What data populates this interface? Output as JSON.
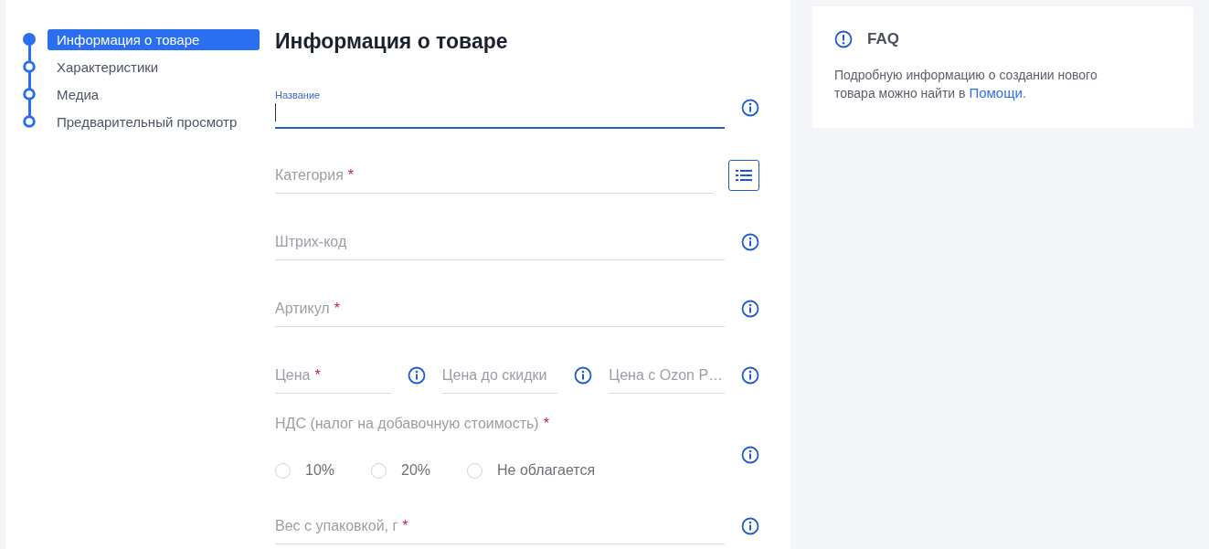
{
  "steps": [
    {
      "label": "Информация о товаре",
      "selected": true
    },
    {
      "label": "Характеристики",
      "selected": false
    },
    {
      "label": "Медиа",
      "selected": false
    },
    {
      "label": "Предварительный просмотр",
      "selected": false
    }
  ],
  "form": {
    "title": "Информация о товаре",
    "fields": [
      {
        "kind": "input",
        "label": "Название",
        "focused": true,
        "has_info": true,
        "has_list_button": false
      },
      {
        "kind": "input",
        "label": "Категория",
        "mark": "*",
        "focused": false,
        "has_info": false,
        "has_list_button": true
      },
      {
        "kind": "input",
        "label": "Штрих-код",
        "focused": false,
        "has_info": true,
        "has_list_button": false
      },
      {
        "kind": "input",
        "label": "Артикул",
        "mark": "*",
        "focused": false,
        "has_info": true,
        "has_list_button": false
      },
      {
        "kind": "row",
        "items": [
          {
            "label": "Цена",
            "mark": "*",
            "focused": false,
            "has_info": true,
            "has_list_button": false
          },
          {
            "label": "Цена до скидки",
            "focused": false,
            "has_info": true,
            "has_list_button": false
          },
          {
            "label": "Цена с Ozon P…",
            "focused": false,
            "has_info": true,
            "has_list_button": false
          }
        ]
      },
      {
        "kind": "radio",
        "label": "НДС (налог на добавочную стоимость)",
        "mark": "*",
        "has_info": true,
        "options": [
          {
            "label": "10%",
            "selected": false
          },
          {
            "label": "20%",
            "selected": false
          },
          {
            "label": "Не облагается",
            "selected": false
          }
        ]
      },
      {
        "kind": "input",
        "label": "Вес с упаковкой, г",
        "mark": "*",
        "focused": false,
        "has_info": true,
        "has_list_button": false
      }
    ]
  },
  "faq": {
    "title": "FAQ",
    "text": "Подробную информацию о создании нового товара можно найти в ",
    "link": "Помощи",
    "after": "."
  }
}
